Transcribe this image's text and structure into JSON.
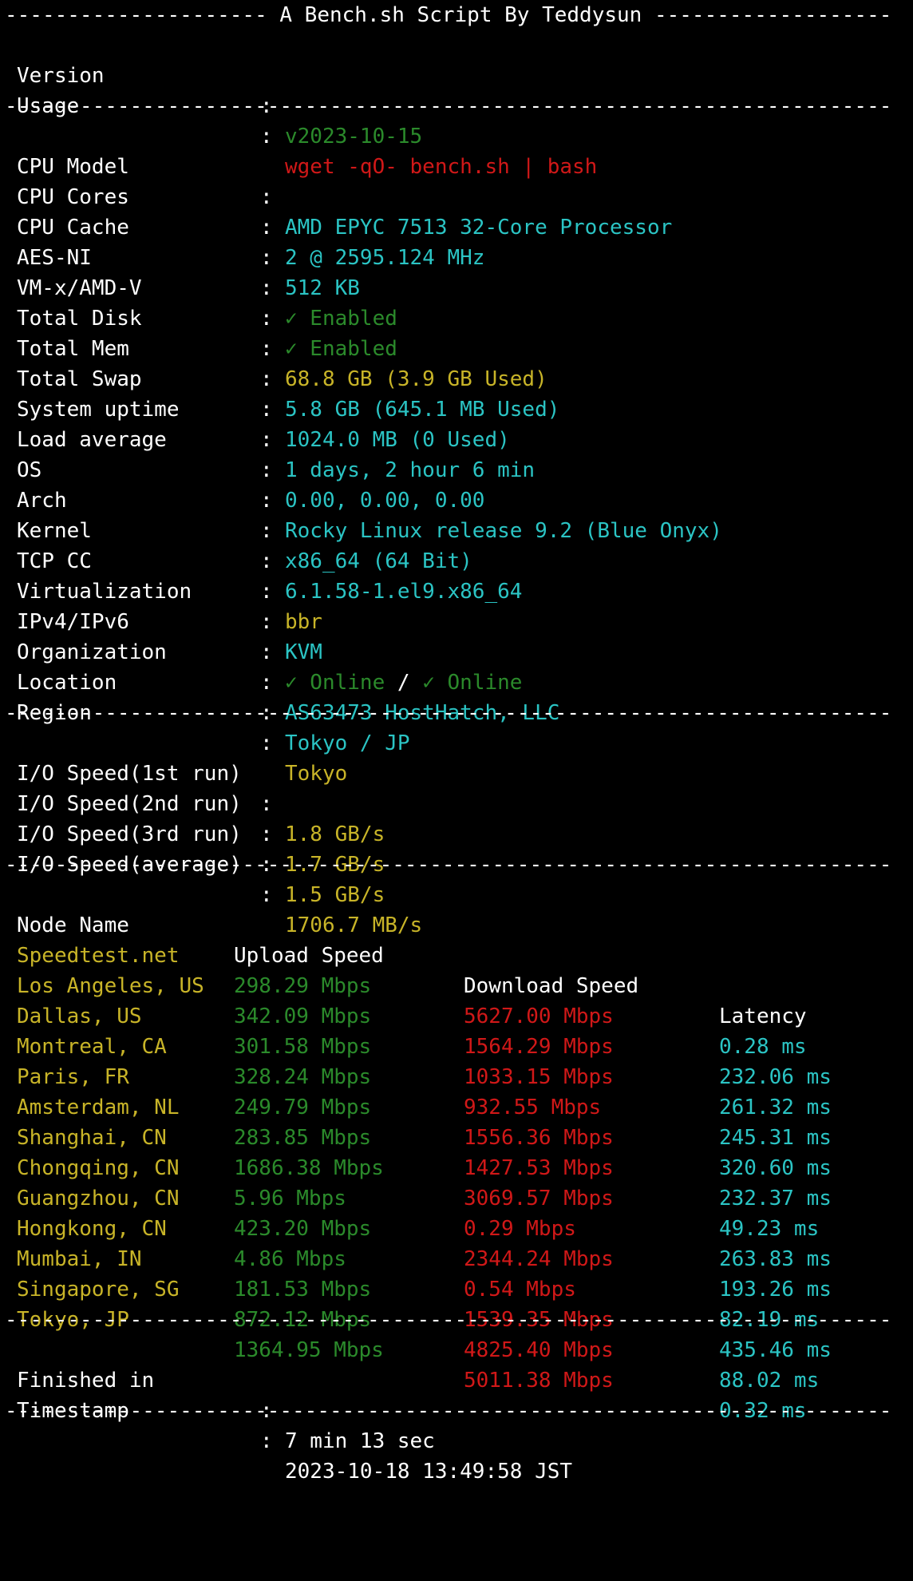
{
  "header": {
    "title_line": "--------------------- A Bench.sh Script By Teddysun -------------------",
    "version_label": "Version",
    "version_value": "v2023-10-15",
    "usage_label": "Usage",
    "usage_value": "wget -qO- bench.sh | bash"
  },
  "separator": "-----------------------------------------------------------------------",
  "colon": ":",
  "system": {
    "cpu_model_label": "CPU Model",
    "cpu_model": "AMD EPYC 7513 32-Core Processor",
    "cpu_cores_label": "CPU Cores",
    "cpu_cores": "2 @ 2595.124 MHz",
    "cpu_cache_label": "CPU Cache",
    "cpu_cache": "512 KB",
    "aes_label": "AES-NI",
    "aes": "✓ Enabled",
    "vmx_label": "VM-x/AMD-V",
    "vmx": "✓ Enabled",
    "disk_label": "Total Disk",
    "disk": "68.8 GB (3.9 GB Used)",
    "mem_label": "Total Mem",
    "mem": "5.8 GB (645.1 MB Used)",
    "swap_label": "Total Swap",
    "swap": "1024.0 MB (0 Used)",
    "uptime_label": "System uptime",
    "uptime": "1 days, 2 hour 6 min",
    "load_label": "Load average",
    "load": "0.00, 0.00, 0.00",
    "os_label": "OS",
    "os": "Rocky Linux release 9.2 (Blue Onyx)",
    "arch_label": "Arch",
    "arch": "x86_64 (64 Bit)",
    "kernel_label": "Kernel",
    "kernel": "6.1.58-1.el9.x86_64",
    "tcpcc_label": "TCP CC",
    "tcpcc": "bbr",
    "virt_label": "Virtualization",
    "virt": "KVM",
    "ip_label": "IPv4/IPv6",
    "ipv4": "✓ Online",
    "ip_sep": " / ",
    "ipv6": "✓ Online",
    "org_label": "Organization",
    "org": "AS63473 HostHatch, LLC",
    "location_label": "Location",
    "location": "Tokyo / JP",
    "region_label": "Region",
    "region": "Tokyo"
  },
  "io": {
    "run1_label": "I/O Speed(1st run)",
    "run1": "1.8 GB/s",
    "run2_label": "I/O Speed(2nd run)",
    "run2": "1.7 GB/s",
    "run3_label": "I/O Speed(3rd run)",
    "run3": "1.5 GB/s",
    "avg_label": "I/O Speed(average)",
    "avg": "1706.7 MB/s"
  },
  "speedtest": {
    "headers": [
      "Node Name",
      "Upload Speed",
      "Download Speed",
      "Latency"
    ],
    "rows": [
      {
        "node": "Speedtest.net",
        "up": "298.29 Mbps",
        "down": "5627.00 Mbps",
        "lat": "0.28 ms"
      },
      {
        "node": "Los Angeles, US",
        "up": "342.09 Mbps",
        "down": "1564.29 Mbps",
        "lat": "232.06 ms"
      },
      {
        "node": "Dallas, US",
        "up": "301.58 Mbps",
        "down": "1033.15 Mbps",
        "lat": "261.32 ms"
      },
      {
        "node": "Montreal, CA",
        "up": "328.24 Mbps",
        "down": "932.55 Mbps",
        "lat": "245.31 ms"
      },
      {
        "node": "Paris, FR",
        "up": "249.79 Mbps",
        "down": "1556.36 Mbps",
        "lat": "320.60 ms"
      },
      {
        "node": "Amsterdam, NL",
        "up": "283.85 Mbps",
        "down": "1427.53 Mbps",
        "lat": "232.37 ms"
      },
      {
        "node": "Shanghai, CN",
        "up": "1686.38 Mbps",
        "down": "3069.57 Mbps",
        "lat": "49.23 ms"
      },
      {
        "node": "Chongqing, CN",
        "up": "5.96 Mbps",
        "down": "0.29 Mbps",
        "lat": "263.83 ms"
      },
      {
        "node": "Guangzhou, CN",
        "up": "423.20 Mbps",
        "down": "2344.24 Mbps",
        "lat": "193.26 ms"
      },
      {
        "node": "Hongkong, CN",
        "up": "4.86 Mbps",
        "down": "0.54 Mbps",
        "lat": "82.19 ms"
      },
      {
        "node": "Mumbai, IN",
        "up": "181.53 Mbps",
        "down": "1539.35 Mbps",
        "lat": "435.46 ms"
      },
      {
        "node": "Singapore, SG",
        "up": "872.12 Mbps",
        "down": "4825.40 Mbps",
        "lat": "88.02 ms"
      },
      {
        "node": "Tokyo, JP",
        "up": "1364.95 Mbps",
        "down": "5011.38 Mbps",
        "lat": "0.32 ms"
      }
    ]
  },
  "footer": {
    "finished_label": "Finished in",
    "finished": "7 min 13 sec",
    "timestamp_label": "Timestamp",
    "timestamp": "2023-10-18 13:49:58 JST"
  },
  "colors": {
    "background": "#000000",
    "text": "#ffffff",
    "green": "#2b8a2b",
    "red": "#d01818",
    "cyan": "#2bc4c4",
    "yellow": "#c8b428"
  }
}
